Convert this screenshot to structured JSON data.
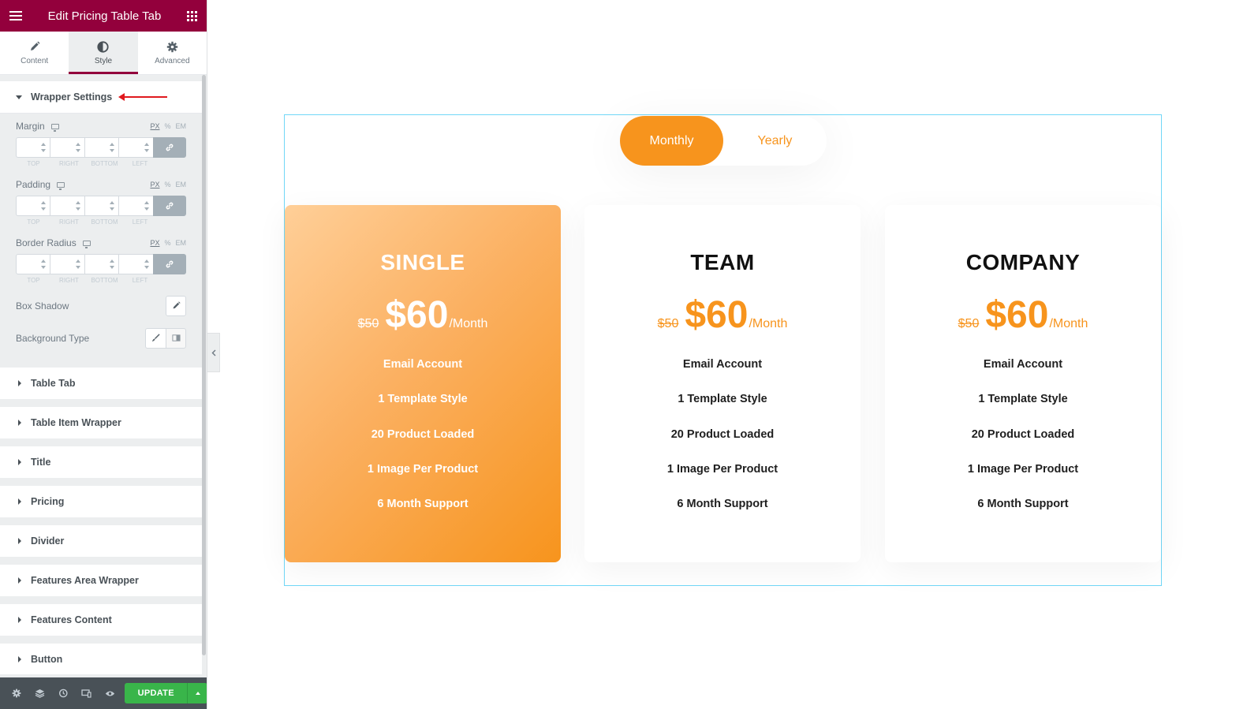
{
  "editor": {
    "title": "Edit Pricing Table Tab",
    "tabs": [
      {
        "label": "Content",
        "icon": "pencil-icon"
      },
      {
        "label": "Style",
        "icon": "half-circle-icon"
      },
      {
        "label": "Advanced",
        "icon": "gear-icon"
      }
    ],
    "active_tab": "Style",
    "accent_color": "#93003c"
  },
  "wrapper_settings": {
    "title": "Wrapper Settings",
    "controls": {
      "margin": {
        "label": "Margin"
      },
      "padding": {
        "label": "Padding"
      },
      "border_radius": {
        "label": "Border Radius"
      }
    },
    "units": [
      "PX",
      "%",
      "EM"
    ],
    "selected_unit": "PX",
    "dimension_labels": [
      "TOP",
      "RIGHT",
      "BOTTOM",
      "LEFT"
    ],
    "box_shadow": {
      "label": "Box Shadow"
    },
    "background_type": {
      "label": "Background Type"
    }
  },
  "sections": [
    "Table Tab",
    "Table Item Wrapper",
    "Title",
    "Pricing",
    "Divider",
    "Features Area Wrapper",
    "Features Content",
    "Button"
  ],
  "footer": {
    "update_label": "UPDATE",
    "update_color": "#39b54a"
  },
  "preview": {
    "toggle": {
      "monthly": "Monthly",
      "yearly": "Yearly",
      "active": "Monthly"
    },
    "accent_color": "#f7941d",
    "plans": [
      {
        "name": "SINGLE",
        "old_price": "$50",
        "price": "$60",
        "period": "/Month",
        "highlighted": true,
        "features": [
          "Email Account",
          "1 Template Style",
          "20 Product Loaded",
          "1 Image Per Product",
          "6 Month Support"
        ]
      },
      {
        "name": "TEAM",
        "old_price": "$50",
        "price": "$60",
        "period": "/Month",
        "highlighted": false,
        "features": [
          "Email Account",
          "1 Template Style",
          "20 Product Loaded",
          "1 Image Per Product",
          "6 Month Support"
        ]
      },
      {
        "name": "COMPANY",
        "old_price": "$50",
        "price": "$60",
        "period": "/Month",
        "highlighted": false,
        "features": [
          "Email Account",
          "1 Template Style",
          "20 Product Loaded",
          "1 Image Per Product",
          "6 Month Support"
        ]
      }
    ]
  }
}
